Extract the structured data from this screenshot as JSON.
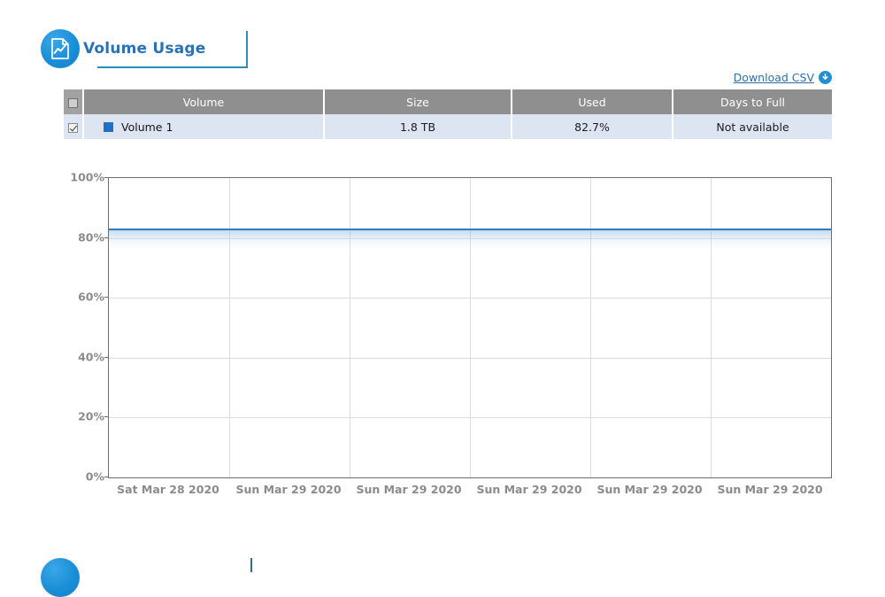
{
  "section": {
    "title": "Volume Usage",
    "icon": "document-chart-icon",
    "accent_color": "#2a72b5"
  },
  "download": {
    "label": "Download CSV",
    "icon": "download-arrow-icon"
  },
  "table": {
    "columns": [
      "",
      "Volume",
      "Size",
      "Used",
      "Days to Full"
    ],
    "header_checkbox_checked": false,
    "rows": [
      {
        "checked": true,
        "swatch_color": "#1f6fc4",
        "volume": "Volume 1",
        "size": "1.8 TB",
        "used": "82.7%",
        "days_to_full": "Not available"
      }
    ]
  },
  "chart_data": {
    "type": "line",
    "title": "Volume Usage",
    "xlabel": "",
    "ylabel": "",
    "ylim": [
      0,
      100
    ],
    "yticks": [
      "0%",
      "20%",
      "40%",
      "60%",
      "80%",
      "100%"
    ],
    "ytick_values": [
      0,
      20,
      40,
      60,
      80,
      100
    ],
    "x": [
      "Sat Mar 28 2020",
      "Sun Mar 29 2020",
      "Sun Mar 29 2020",
      "Sun Mar 29 2020",
      "Sun Mar 29 2020",
      "Sun Mar 29 2020"
    ],
    "grid": true,
    "legend": "none",
    "series": [
      {
        "name": "Volume 1",
        "color": "#2e7ebe",
        "values": [
          82.7,
          82.7,
          82.7,
          82.7,
          82.7,
          82.7
        ]
      }
    ]
  }
}
